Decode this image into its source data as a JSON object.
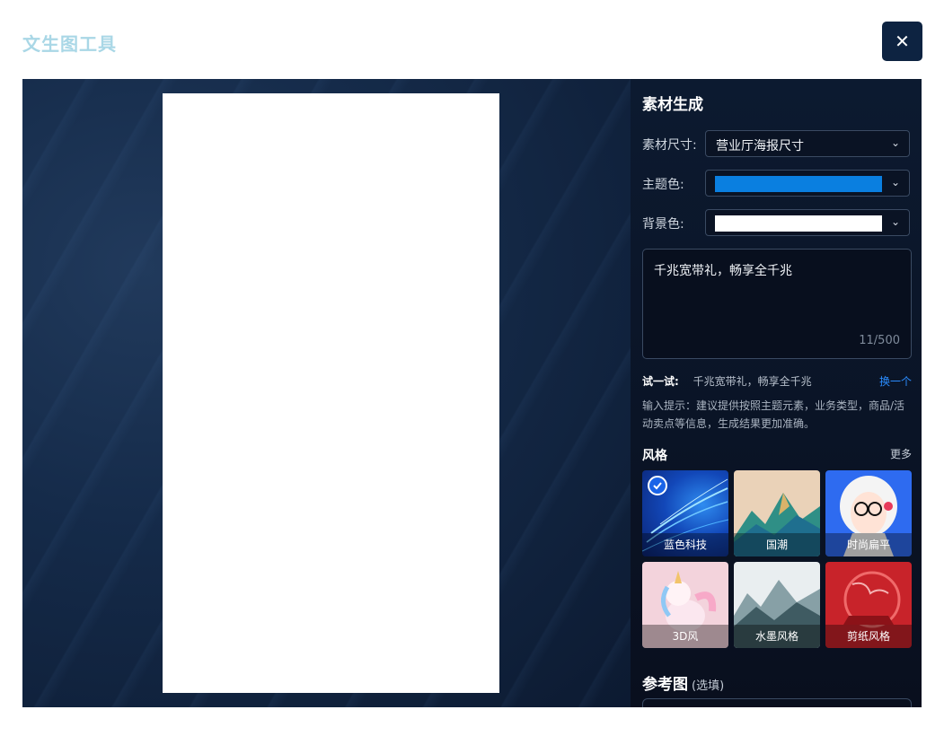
{
  "window": {
    "title": "文生图工具",
    "close_icon": "close-icon"
  },
  "panel": {
    "title": "素材生成",
    "size": {
      "label": "素材尺寸:",
      "value": "营业厅海报尺寸"
    },
    "theme_color": {
      "label": "主题色:",
      "color": "#0a7fe0"
    },
    "bg_color": {
      "label": "背景色:",
      "color": "#ffffff"
    },
    "prompt": {
      "value": "千兆宽带礼，畅享全千兆",
      "count": "11/500"
    },
    "try": {
      "label": "试一试:",
      "example": "千兆宽带礼，畅享全千兆",
      "change": "换一个"
    },
    "hint": "输入提示：建议提供按照主题元素，业务类型，商品/活动卖点等信息，生成结果更加准确。",
    "style": {
      "title": "风格",
      "more": "更多",
      "items": [
        {
          "label": "蓝色科技",
          "selected": true
        },
        {
          "label": "国潮",
          "selected": false
        },
        {
          "label": "时尚扁平",
          "selected": false
        },
        {
          "label": "3D风",
          "selected": false
        },
        {
          "label": "水墨风格",
          "selected": false
        },
        {
          "label": "剪纸风格",
          "selected": false
        }
      ]
    },
    "reference": {
      "title": "参考图",
      "optional": "(选填)"
    }
  }
}
